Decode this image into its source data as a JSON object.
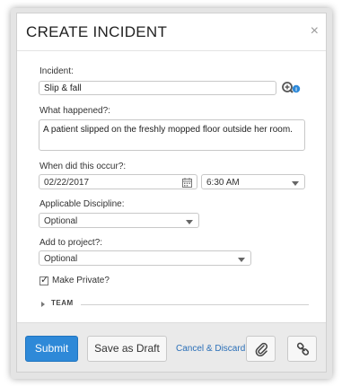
{
  "dialog": {
    "title": "CREATE INCIDENT",
    "close_glyph": "×"
  },
  "form": {
    "incident": {
      "label": "Incident:",
      "value": "Slip & fall",
      "search_icon": "zoom-info-icon"
    },
    "what_happened": {
      "label": "What happened?:",
      "value": "A patient slipped on the freshly mopped floor outside her room."
    },
    "when": {
      "label": "When did this occur?:",
      "date": "02/22/2017",
      "time": "6:30 AM",
      "date_icon": "calendar-icon"
    },
    "discipline": {
      "label": "Applicable Discipline:",
      "value": "Optional"
    },
    "project": {
      "label": "Add to project?:",
      "value": "Optional"
    },
    "private": {
      "label": "Make Private?",
      "checked": true
    },
    "team": {
      "label": "TEAM"
    }
  },
  "footer": {
    "submit_label": "Submit",
    "draft_label": "Save as Draft",
    "discard_label": "Cancel & Discard",
    "attach_icon": "paperclip-icon",
    "link_icon": "link-icon"
  },
  "colors": {
    "primary": "#2e89d8",
    "link": "#2a6fb8",
    "footer_bg": "#eaeaea"
  }
}
